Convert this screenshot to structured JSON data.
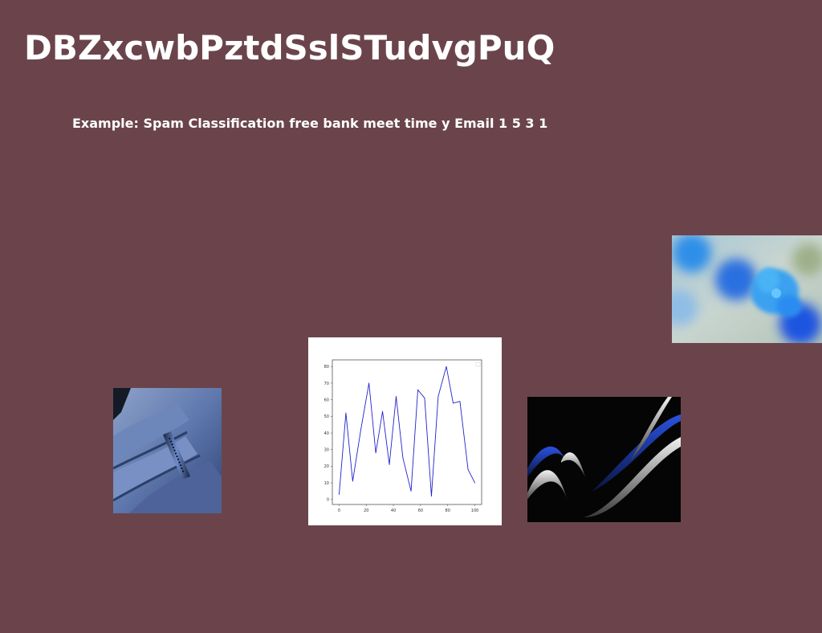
{
  "page": {
    "title": "DBZxcwbPztdSslSTudvgPuQ",
    "subtitle": "Example: Spam Classification free bank meet time y Email 1 5 3 1",
    "colors": {
      "background": "#6b444b",
      "text": "#ffffff",
      "line": "#2222cc"
    }
  },
  "images": [
    {
      "name": "blue-flower-photo"
    },
    {
      "name": "line-chart-image"
    },
    {
      "name": "ring-hand-photo"
    },
    {
      "name": "abstract-waves-image"
    }
  ],
  "chart_data": {
    "type": "line",
    "x": [
      0,
      5,
      10,
      16,
      22,
      27,
      32,
      37,
      42,
      47,
      53,
      58,
      63,
      68,
      73,
      79,
      84,
      89,
      95,
      100
    ],
    "y": [
      3,
      52,
      11,
      42,
      70,
      28,
      53,
      21,
      62,
      25,
      5,
      66,
      61,
      2,
      62,
      80,
      58,
      59,
      18,
      10
    ],
    "xlim": [
      -5,
      105
    ],
    "ylim": [
      -3,
      84
    ],
    "xticks": [
      "0",
      "20",
      "40",
      "60",
      "80",
      "100"
    ],
    "yticks": [
      "0",
      "10",
      "20",
      "30",
      "40",
      "50",
      "60",
      "70",
      "80"
    ],
    "grid": false,
    "legend": "top-right",
    "title": "",
    "xlabel": "",
    "ylabel": ""
  }
}
